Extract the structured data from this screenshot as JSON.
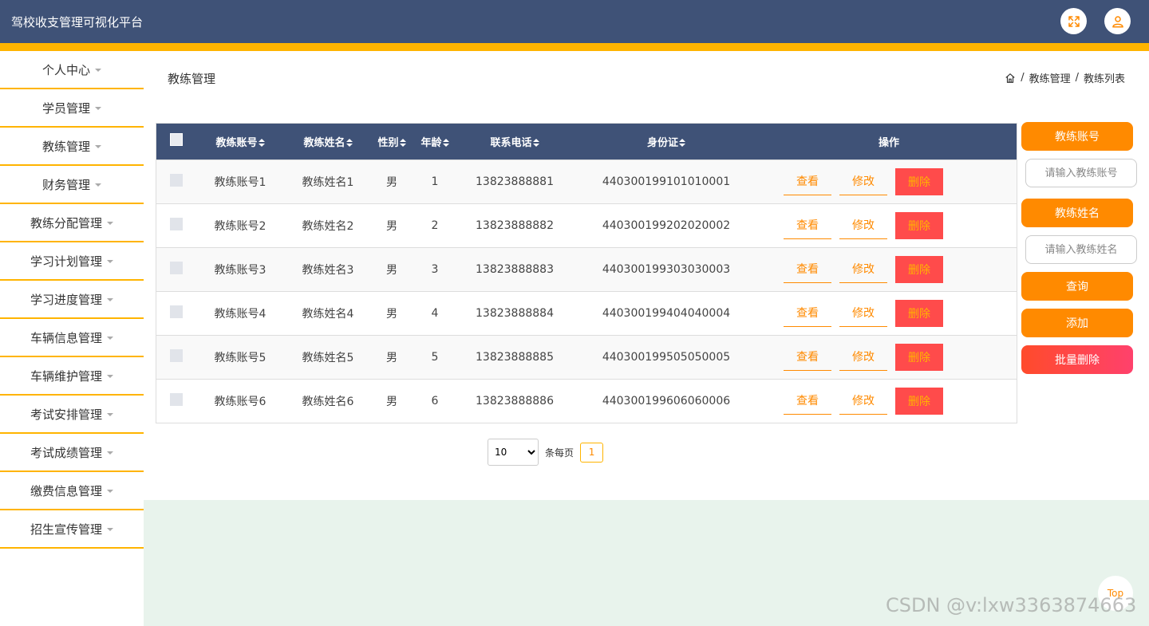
{
  "app": {
    "title": "驾校收支管理可视化平台",
    "icons": [
      "fullscreen-icon",
      "user-icon"
    ]
  },
  "sidebar": {
    "items": [
      {
        "label": "个人中心"
      },
      {
        "label": "学员管理"
      },
      {
        "label": "教练管理"
      },
      {
        "label": "财务管理"
      },
      {
        "label": "教练分配管理"
      },
      {
        "label": "学习计划管理"
      },
      {
        "label": "学习进度管理"
      },
      {
        "label": "车辆信息管理"
      },
      {
        "label": "车辆维护管理"
      },
      {
        "label": "考试安排管理"
      },
      {
        "label": "考试成绩管理"
      },
      {
        "label": "缴费信息管理"
      },
      {
        "label": "招生宣传管理"
      }
    ]
  },
  "page": {
    "title": "教练管理",
    "breadcrumb": [
      "教练管理",
      "教练列表"
    ],
    "breadcrumb_sep": "/"
  },
  "table": {
    "columns": [
      "教练账号",
      "教练姓名",
      "性别",
      "年龄",
      "联系电话",
      "身份证",
      "操作"
    ],
    "rows": [
      [
        "教练账号1",
        "教练姓名1",
        "男",
        "1",
        "13823888881",
        "440300199101010001"
      ],
      [
        "教练账号2",
        "教练姓名2",
        "男",
        "2",
        "13823888882",
        "440300199202020002"
      ],
      [
        "教练账号3",
        "教练姓名3",
        "男",
        "3",
        "13823888883",
        "440300199303030003"
      ],
      [
        "教练账号4",
        "教练姓名4",
        "男",
        "4",
        "13823888884",
        "440300199404040004"
      ],
      [
        "教练账号5",
        "教练姓名5",
        "男",
        "5",
        "13823888885",
        "440300199505050005"
      ],
      [
        "教练账号6",
        "教练姓名6",
        "男",
        "6",
        "13823888886",
        "440300199606060006"
      ]
    ],
    "actions": {
      "view": "查看",
      "edit": "修改",
      "delete": "删除"
    }
  },
  "search": {
    "account_label": "教练账号",
    "account_placeholder": "请输入教练账号",
    "name_label": "教练姓名",
    "name_placeholder": "请输入教练姓名",
    "query": "查询",
    "add": "添加",
    "batch_delete": "批量删除"
  },
  "pagination": {
    "page_size": "10",
    "per_page_label": "条每页",
    "current_page": "1"
  },
  "back_to_top": "Top",
  "watermark": "CSDN @v:lxw3363874663",
  "colors": {
    "header": "#3f5277",
    "accent": "#ffb400",
    "button": "#ff8a00",
    "danger": "#ff4b4b",
    "footer_bg": "#e8f3ec"
  }
}
